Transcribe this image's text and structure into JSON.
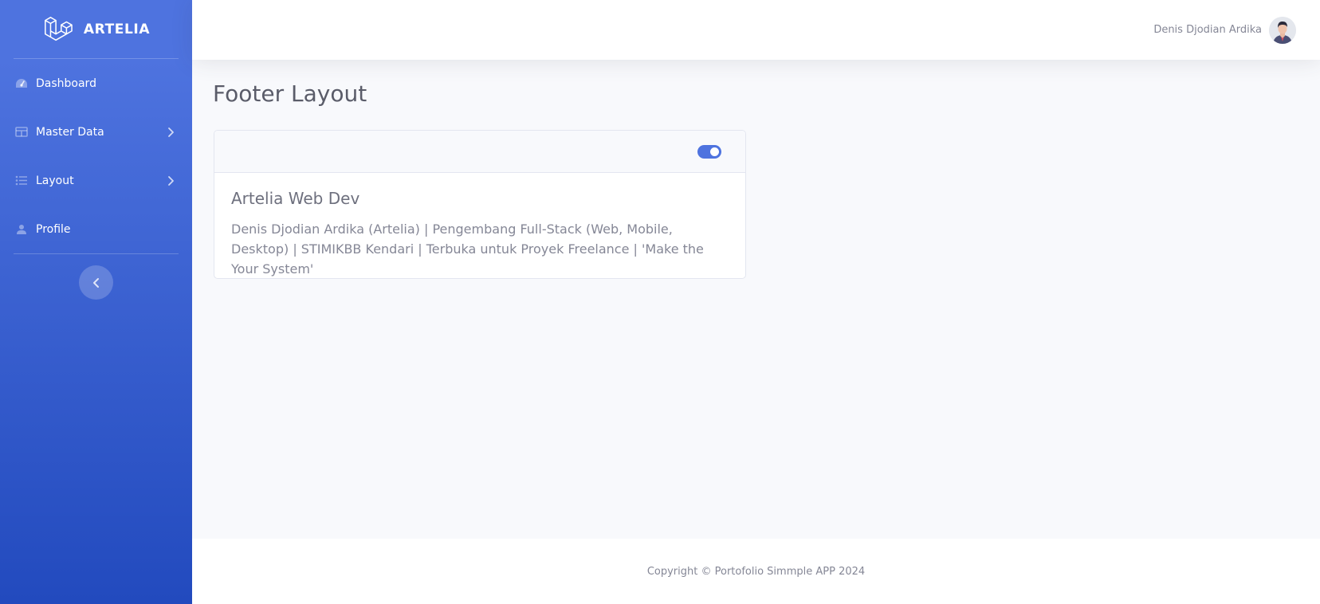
{
  "brand": {
    "name": "ARTELIA",
    "logo_icon": "laravel-logo-icon"
  },
  "sidebar": {
    "items": [
      {
        "label": "Dashboard",
        "icon": "tachometer-icon",
        "has_caret": false
      },
      {
        "label": "Master Data",
        "icon": "table-icon",
        "has_caret": true
      },
      {
        "label": "Layout",
        "icon": "list-icon",
        "has_caret": true
      },
      {
        "label": "Profile",
        "icon": "user-icon",
        "has_caret": false
      }
    ],
    "toggle_icon": "chevron-left-icon"
  },
  "topbar": {
    "user_name": "Denis Djodian Ardika",
    "avatar_icon": "avatar"
  },
  "main": {
    "page_title": "Footer Layout",
    "card": {
      "switch_on": true,
      "title": "Artelia Web Dev",
      "text": "Denis Djodian Ardika (Artelia) | Pengembang Full-Stack (Web, Mobile, Desktop) | STIMIKBB Kendari | Terbuka untuk Proyek Freelance | 'Make the Your System'"
    }
  },
  "footer": {
    "copyright": "Copyright © Portofolio Simmple APP 2024"
  },
  "colors": {
    "primary": "#4e73df",
    "primary_dark": "#224abe",
    "text_muted": "#858796",
    "heading": "#5a5c69"
  }
}
